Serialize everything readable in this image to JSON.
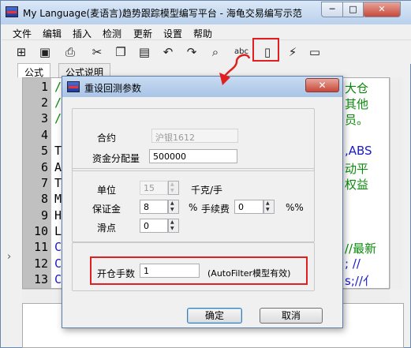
{
  "window": {
    "title": "My Language(麦语言)趋势跟踪模型编写平台 - 海龟交易编写示范",
    "min": "─",
    "max": "□",
    "close": "✕"
  },
  "menu": [
    "文件",
    "编辑",
    "插入",
    "检测",
    "更新",
    "设置",
    "帮助"
  ],
  "toolbar": {
    "icons": [
      "new-file-icon",
      "save-icon",
      "print-icon",
      "cut-icon",
      "copy-icon",
      "paste-icon",
      "undo-icon",
      "redo-icon",
      "find-icon",
      "spellcheck-icon",
      "backtest-params-icon",
      "run-icon",
      "report-icon"
    ],
    "spellcheck_label": "abc"
  },
  "tabs": [
    "公式",
    "公式说明"
  ],
  "editor": {
    "line_numbers": [
      "1",
      "2",
      "3",
      "4",
      "5",
      "6",
      "7",
      "8",
      "9",
      "10",
      "11",
      "12",
      "13"
    ],
    "lines_left": [
      "//",
      "//",
      "//",
      "",
      "TU",
      "A",
      "T",
      "M",
      "H",
      "L",
      "C",
      "C",
      "C"
    ],
    "right_fragments": [
      {
        "text": "大仓",
        "color": "#0a8a0a"
      },
      {
        "text": "其他",
        "color": "#0a8a0a"
      },
      {
        "text": "员。",
        "color": "#0a8a0a"
      },
      {
        "text": ",ABS",
        "color": "#1a1ac8"
      },
      {
        "text": "动平",
        "color": "#0a8a0a"
      },
      {
        "text": "权益",
        "color": "#0a8a0a"
      },
      {
        "text": "//最新",
        "color": "#0a8a0a"
      },
      {
        "text": "; //",
        "color": "#1a1ac8"
      },
      {
        "text": "s;//亻",
        "color": "#1a1ac8"
      }
    ]
  },
  "dialog": {
    "title": "重设回测参数",
    "close": "✕",
    "contract_label": "合约",
    "contract_value": "沪银1612",
    "capital_label": "资金分配量",
    "capital_value": "500000",
    "unit_label": "单位",
    "unit_value": "15",
    "unit_suffix": "千克/手",
    "margin_label": "保证金",
    "margin_value": "8",
    "margin_suffix": "%",
    "fee_label": "手续费",
    "fee_value": "0",
    "fee_suffix": "%%",
    "slippage_label": "滑点",
    "slippage_value": "0",
    "open_lots_label": "开仓手数",
    "open_lots_value": "1",
    "open_lots_note": "(AutoFilter模型有效)",
    "ok": "确定",
    "cancel": "取消"
  },
  "colors": {
    "highlight_red": "#e02020",
    "comment_green": "#0a8a0a",
    "keyword_blue": "#1a1ac8"
  }
}
